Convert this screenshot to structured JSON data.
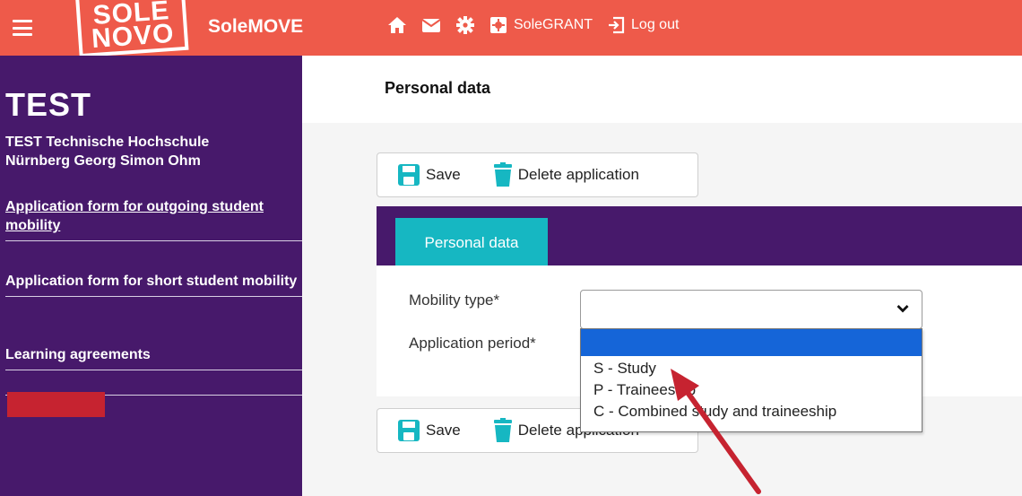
{
  "topbar": {
    "logo_line1": "SOLE",
    "logo_line2": "NOVO",
    "app_title": "SoleMOVE",
    "icons": [
      "home-icon",
      "mail-icon",
      "gear-icon",
      "grant-icon",
      "logout-icon"
    ],
    "grant_label": "SoleGRANT",
    "logout_label": "Log out",
    "color": "#ee5a4a"
  },
  "sidebar": {
    "big_title": "TEST",
    "institution": "TEST Technische Hochschule Nürnberg Georg Simon Ohm",
    "items": [
      {
        "label": "Application form for outgoing student mobility"
      },
      {
        "label": "Application form for short student mobility"
      },
      {
        "label": "Learning agreements"
      }
    ],
    "color": "#47196b"
  },
  "main": {
    "page_title": "Personal data",
    "toolbar": {
      "save_label": "Save",
      "delete_label": "Delete application"
    },
    "tab_label": "Personal data",
    "fields": {
      "mobility_type_label": "Mobility type*",
      "application_period_label": "Application period*"
    },
    "dropdown": {
      "selected_value": "",
      "options": [
        "S - Study",
        "P - Traineeship",
        "C - Combined study and traineeship"
      ]
    },
    "colors": {
      "tab": "#16b7c2",
      "save_icon": "#16b7c2",
      "highlight": "#1565d8",
      "arrow": "#c62330"
    }
  }
}
